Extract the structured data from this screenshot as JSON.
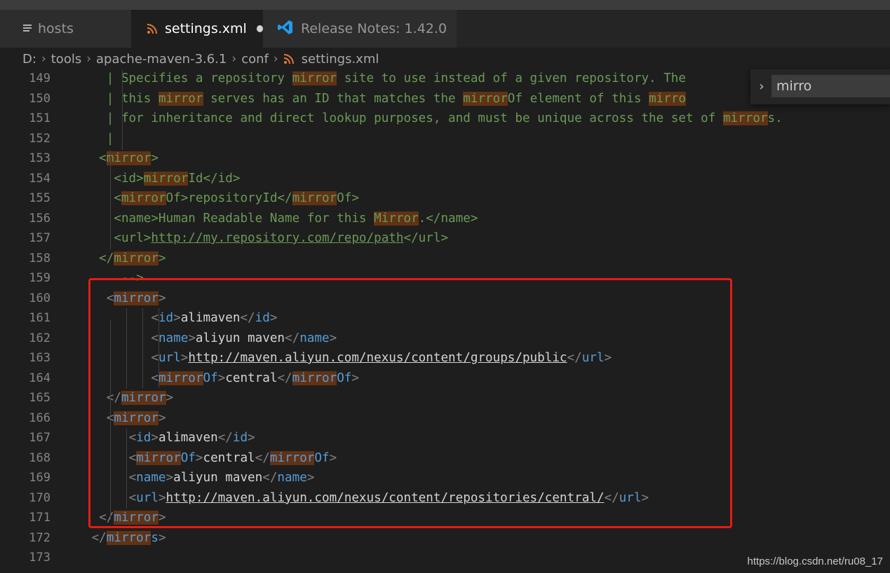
{
  "tabs": [
    {
      "label": "hosts",
      "icon": "file-lines-icon"
    },
    {
      "label": "settings.xml",
      "icon": "rss-xml-icon",
      "dirty": true
    },
    {
      "label": "Release Notes: 1.42.0",
      "icon": "vscode-icon"
    }
  ],
  "breadcrumb": [
    "D:",
    "tools",
    "apache-maven-3.6.1",
    "conf",
    "settings.xml"
  ],
  "find": {
    "value": "mirro"
  },
  "watermark": "https://blog.csdn.net/ru08_17",
  "colors": {
    "highlight": "#613214",
    "comment": "#6a9955",
    "tag": "#569cd6",
    "redbox": "#e51c14"
  },
  "lines": [
    {
      "n": "149",
      "segs": [
        {
          "t": "   | Specifies a repository ",
          "c": "cmt"
        },
        {
          "t": "mirror",
          "c": "cmt hl"
        },
        {
          "t": " site to use instead of a given repository. The",
          "c": "cmt"
        }
      ]
    },
    {
      "n": "150",
      "segs": [
        {
          "t": "   | this ",
          "c": "cmt"
        },
        {
          "t": "mirror",
          "c": "cmt hl"
        },
        {
          "t": " serves has an ID that matches the ",
          "c": "cmt"
        },
        {
          "t": "mirror",
          "c": "cmt hl"
        },
        {
          "t": "Of element of this ",
          "c": "cmt"
        },
        {
          "t": "mirro",
          "c": "cmt hl"
        }
      ]
    },
    {
      "n": "151",
      "segs": [
        {
          "t": "   | for inheritance and direct lookup purposes, and must be unique across the set of ",
          "c": "cmt"
        },
        {
          "t": "mirror",
          "c": "cmt hl"
        },
        {
          "t": "s.",
          "c": "cmt"
        }
      ]
    },
    {
      "n": "152",
      "segs": [
        {
          "t": "   |",
          "c": "cmt"
        }
      ]
    },
    {
      "n": "153",
      "segs": [
        {
          "t": "  <",
          "c": "cmt"
        },
        {
          "t": "mirror",
          "c": "cmt hl"
        },
        {
          "t": ">",
          "c": "cmt"
        }
      ]
    },
    {
      "n": "154",
      "segs": [
        {
          "t": "    <id>",
          "c": "cmt"
        },
        {
          "t": "mirror",
          "c": "cmt hl"
        },
        {
          "t": "Id</id>",
          "c": "cmt"
        }
      ]
    },
    {
      "n": "155",
      "segs": [
        {
          "t": "    <",
          "c": "cmt"
        },
        {
          "t": "mirror",
          "c": "cmt hl"
        },
        {
          "t": "Of>repositoryId</",
          "c": "cmt"
        },
        {
          "t": "mirror",
          "c": "cmt hl"
        },
        {
          "t": "Of>",
          "c": "cmt"
        }
      ]
    },
    {
      "n": "156",
      "segs": [
        {
          "t": "    <name>Human Readable Name for this ",
          "c": "cmt"
        },
        {
          "t": "Mirror",
          "c": "cmt hl"
        },
        {
          "t": ".</name>",
          "c": "cmt"
        }
      ]
    },
    {
      "n": "157",
      "segs": [
        {
          "t": "    <url>",
          "c": "cmt"
        },
        {
          "t": "http://my.repository.com/repo/path",
          "c": "cmt url"
        },
        {
          "t": "</url>",
          "c": "cmt"
        }
      ]
    },
    {
      "n": "158",
      "segs": [
        {
          "t": "  </",
          "c": "cmt"
        },
        {
          "t": "mirror",
          "c": "cmt hl"
        },
        {
          "t": ">",
          "c": "cmt"
        }
      ]
    },
    {
      "n": "159",
      "segs": [
        {
          "t": "     -->",
          "c": "cmt"
        }
      ]
    },
    {
      "n": "160",
      "segs": [
        {
          "t": "   ",
          "c": "txt"
        },
        {
          "t": "<",
          "c": "ang"
        },
        {
          "t": "mirror",
          "c": "tag hl"
        },
        {
          "t": ">",
          "c": "ang"
        }
      ]
    },
    {
      "n": "161",
      "segs": [
        {
          "t": "         ",
          "c": "txt"
        },
        {
          "t": "<",
          "c": "ang"
        },
        {
          "t": "id",
          "c": "tag"
        },
        {
          "t": ">",
          "c": "ang"
        },
        {
          "t": "alimaven",
          "c": "txt"
        },
        {
          "t": "</",
          "c": "ang"
        },
        {
          "t": "id",
          "c": "tag"
        },
        {
          "t": ">",
          "c": "ang"
        }
      ]
    },
    {
      "n": "162",
      "segs": [
        {
          "t": "         ",
          "c": "txt"
        },
        {
          "t": "<",
          "c": "ang"
        },
        {
          "t": "name",
          "c": "tag"
        },
        {
          "t": ">",
          "c": "ang"
        },
        {
          "t": "aliyun maven",
          "c": "txt"
        },
        {
          "t": "</",
          "c": "ang"
        },
        {
          "t": "name",
          "c": "tag"
        },
        {
          "t": ">",
          "c": "ang"
        }
      ]
    },
    {
      "n": "163",
      "segs": [
        {
          "t": "         ",
          "c": "txt"
        },
        {
          "t": "<",
          "c": "ang"
        },
        {
          "t": "url",
          "c": "tag"
        },
        {
          "t": ">",
          "c": "ang"
        },
        {
          "t": "http://maven.aliyun.com/nexus/content/groups/public",
          "c": "txt url"
        },
        {
          "t": "</",
          "c": "ang"
        },
        {
          "t": "url",
          "c": "tag"
        },
        {
          "t": ">",
          "c": "ang"
        }
      ]
    },
    {
      "n": "164",
      "segs": [
        {
          "t": "         ",
          "c": "txt"
        },
        {
          "t": "<",
          "c": "ang"
        },
        {
          "t": "mirror",
          "c": "tag hl"
        },
        {
          "t": "Of",
          "c": "tag"
        },
        {
          "t": ">",
          "c": "ang"
        },
        {
          "t": "central",
          "c": "txt"
        },
        {
          "t": "</",
          "c": "ang"
        },
        {
          "t": "mirror",
          "c": "tag hl"
        },
        {
          "t": "Of",
          "c": "tag"
        },
        {
          "t": ">",
          "c": "ang"
        }
      ]
    },
    {
      "n": "165",
      "segs": [
        {
          "t": "   ",
          "c": "txt"
        },
        {
          "t": "</",
          "c": "ang"
        },
        {
          "t": "mirror",
          "c": "tag hl"
        },
        {
          "t": ">",
          "c": "ang"
        }
      ]
    },
    {
      "n": "166",
      "segs": [
        {
          "t": "   ",
          "c": "txt"
        },
        {
          "t": "<",
          "c": "ang"
        },
        {
          "t": "mirror",
          "c": "tag hl"
        },
        {
          "t": ">",
          "c": "ang"
        }
      ]
    },
    {
      "n": "167",
      "segs": [
        {
          "t": "      ",
          "c": "txt"
        },
        {
          "t": "<",
          "c": "ang"
        },
        {
          "t": "id",
          "c": "tag"
        },
        {
          "t": ">",
          "c": "ang"
        },
        {
          "t": "alimaven",
          "c": "txt"
        },
        {
          "t": "</",
          "c": "ang"
        },
        {
          "t": "id",
          "c": "tag"
        },
        {
          "t": ">",
          "c": "ang"
        }
      ]
    },
    {
      "n": "168",
      "segs": [
        {
          "t": "      ",
          "c": "txt"
        },
        {
          "t": "<",
          "c": "ang"
        },
        {
          "t": "mirror",
          "c": "tag hl"
        },
        {
          "t": "Of",
          "c": "tag"
        },
        {
          "t": ">",
          "c": "ang"
        },
        {
          "t": "central",
          "c": "txt"
        },
        {
          "t": "</",
          "c": "ang"
        },
        {
          "t": "mirror",
          "c": "tag hl"
        },
        {
          "t": "Of",
          "c": "tag"
        },
        {
          "t": ">",
          "c": "ang"
        }
      ]
    },
    {
      "n": "169",
      "segs": [
        {
          "t": "      ",
          "c": "txt"
        },
        {
          "t": "<",
          "c": "ang"
        },
        {
          "t": "name",
          "c": "tag"
        },
        {
          "t": ">",
          "c": "ang"
        },
        {
          "t": "aliyun maven",
          "c": "txt"
        },
        {
          "t": "</",
          "c": "ang"
        },
        {
          "t": "name",
          "c": "tag"
        },
        {
          "t": ">",
          "c": "ang"
        }
      ]
    },
    {
      "n": "170",
      "segs": [
        {
          "t": "      ",
          "c": "txt"
        },
        {
          "t": "<",
          "c": "ang"
        },
        {
          "t": "url",
          "c": "tag"
        },
        {
          "t": ">",
          "c": "ang"
        },
        {
          "t": "http://maven.aliyun.com/nexus/content/repositories/central/",
          "c": "txt url"
        },
        {
          "t": "</",
          "c": "ang"
        },
        {
          "t": "url",
          "c": "tag"
        },
        {
          "t": ">",
          "c": "ang"
        }
      ]
    },
    {
      "n": "171",
      "segs": [
        {
          "t": "  ",
          "c": "txt"
        },
        {
          "t": "</",
          "c": "ang"
        },
        {
          "t": "mirror",
          "c": "tag hl"
        },
        {
          "t": ">",
          "c": "ang"
        }
      ]
    },
    {
      "n": "172",
      "segs": [
        {
          "t": " ",
          "c": "txt"
        },
        {
          "t": "</",
          "c": "ang"
        },
        {
          "t": "mirror",
          "c": "tag hl"
        },
        {
          "t": "s",
          "c": "tag"
        },
        {
          "t": ">",
          "c": "ang"
        }
      ]
    },
    {
      "n": "173",
      "segs": []
    }
  ]
}
